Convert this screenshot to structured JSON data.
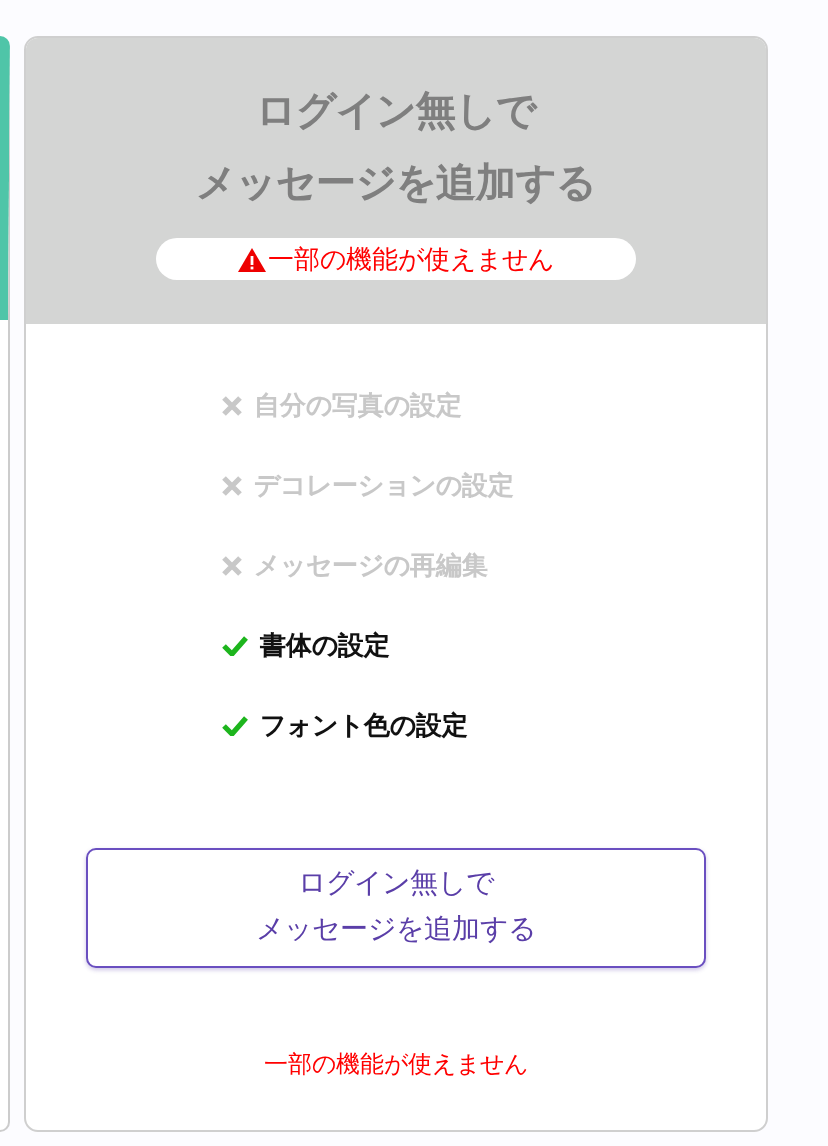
{
  "card": {
    "title_lines": [
      "ログイン無しで",
      "メッセージを追加する"
    ],
    "warning_badge": "一部の機能が使えません",
    "features": [
      {
        "label": "自分の写真の設定",
        "available": false
      },
      {
        "label": "デコレーションの設定",
        "available": false
      },
      {
        "label": "メッセージの再編集",
        "available": false
      },
      {
        "label": "書体の設定",
        "available": true
      },
      {
        "label": "フォント色の設定",
        "available": true
      }
    ],
    "button_lines": [
      "ログイン無しで",
      "メッセージを追加する"
    ],
    "footer_note": "一部の機能が使えません"
  }
}
